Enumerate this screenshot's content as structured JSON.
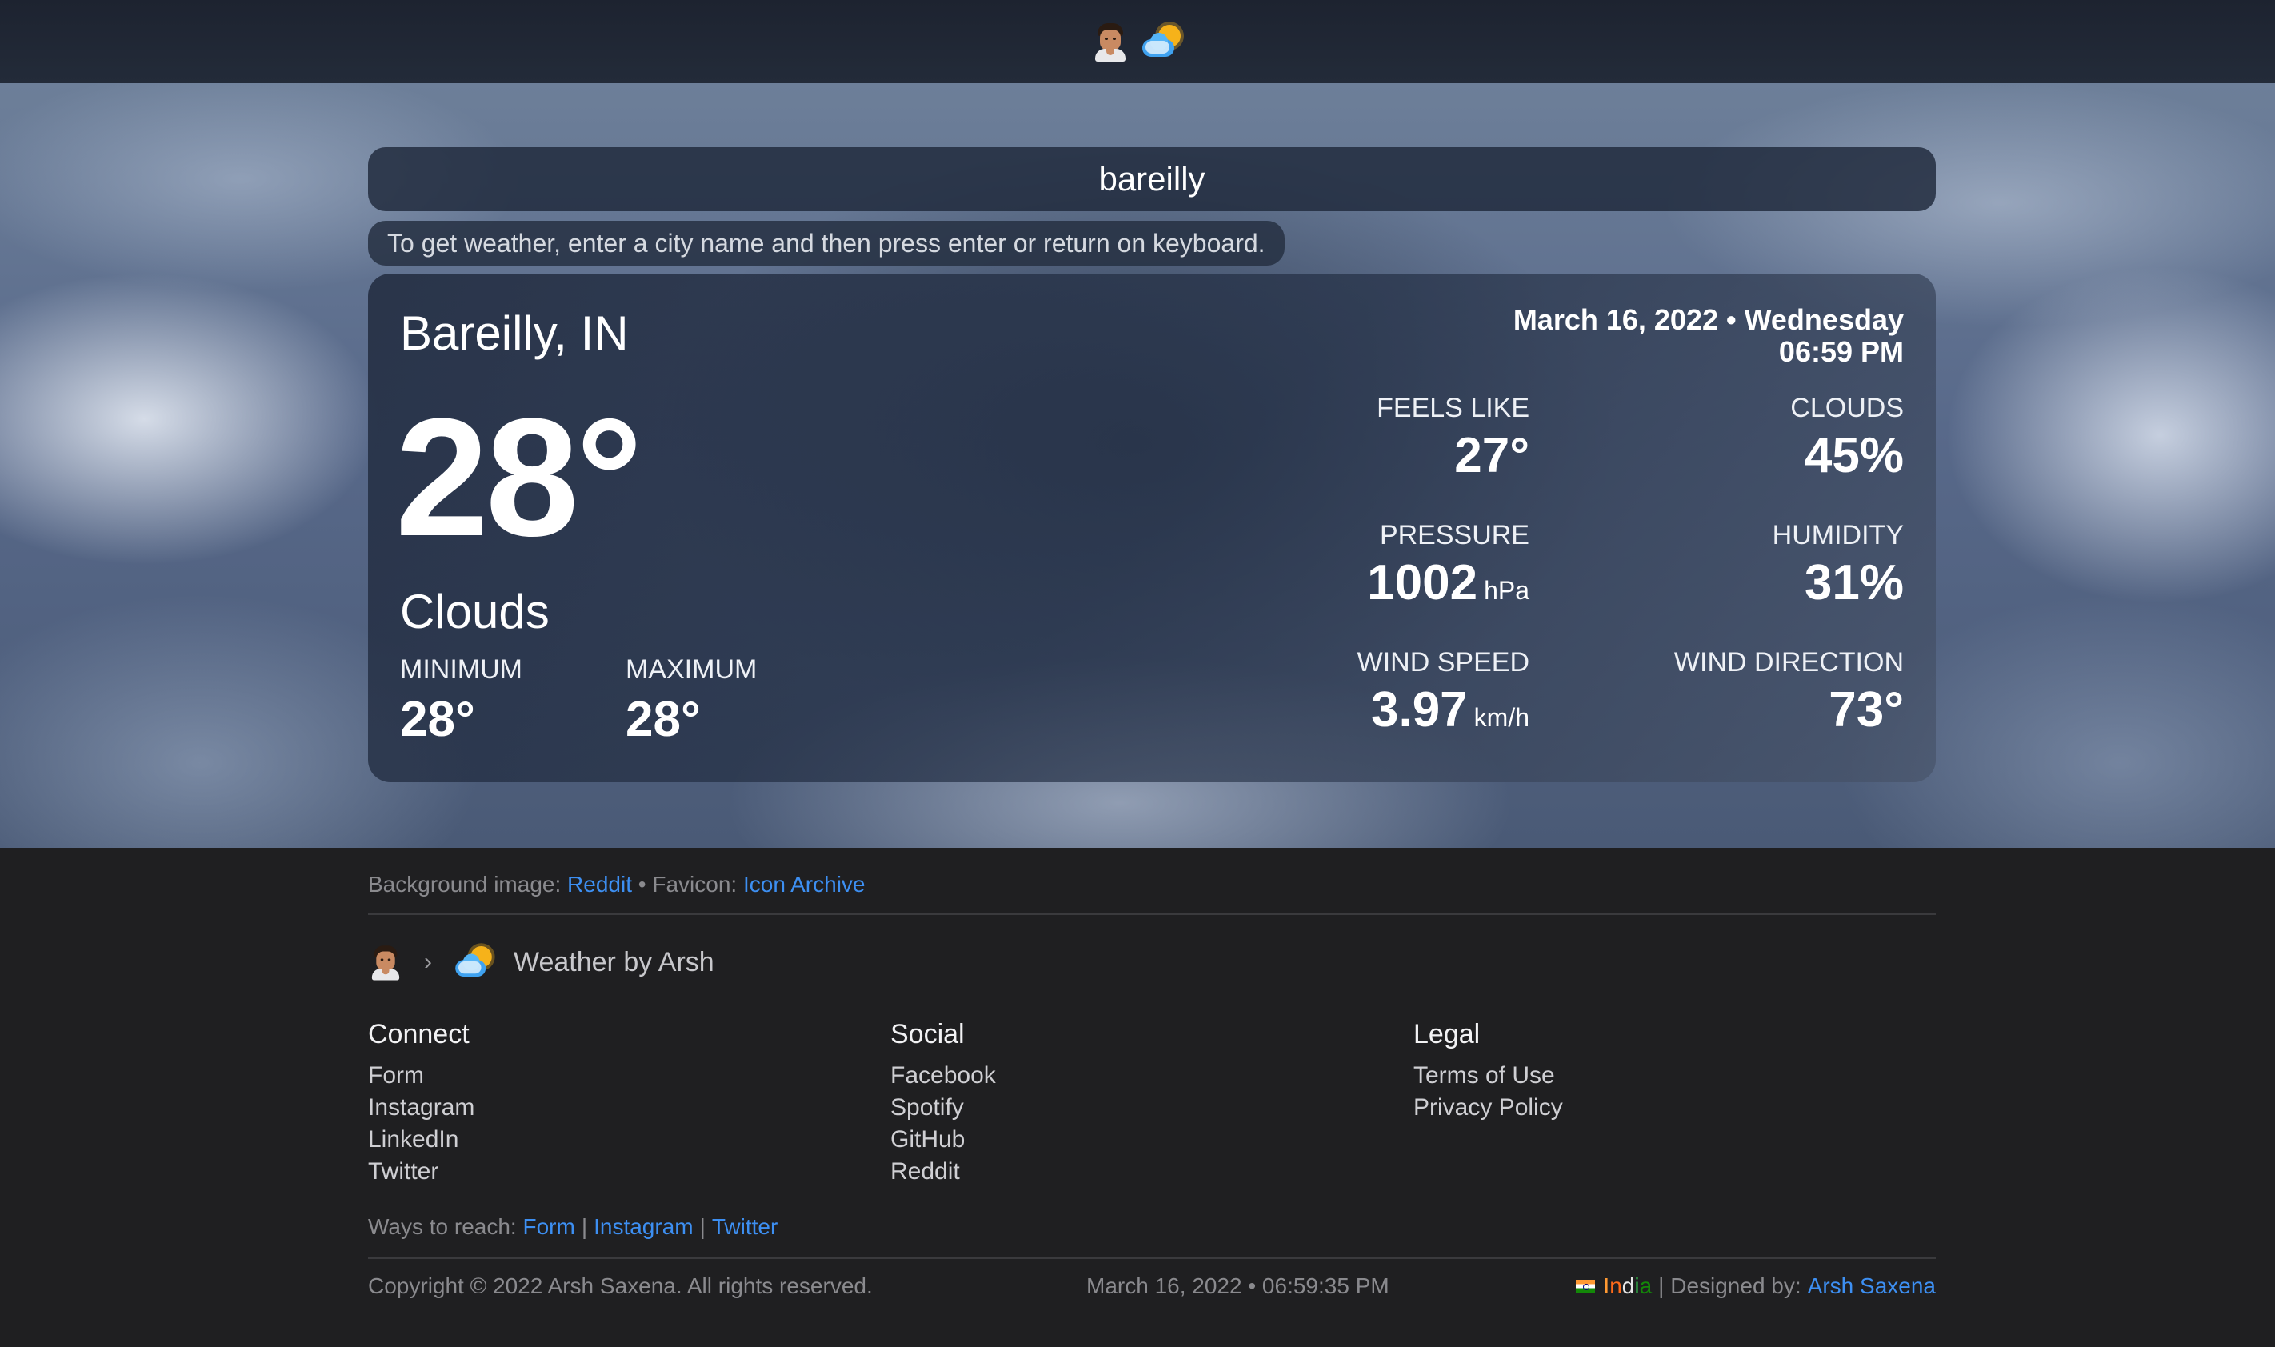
{
  "search": {
    "value": "bareilly",
    "hint": "To get weather, enter a city name and then press enter or return on keyboard."
  },
  "weather": {
    "city": "Bareilly, IN",
    "temperature": "28°",
    "condition": "Clouds",
    "min_label": "MINIMUM",
    "min_value": "28°",
    "max_label": "MAXIMUM",
    "max_value": "28°",
    "date_line": "March 16, 2022 • Wednesday",
    "time_line": "06:59 PM",
    "feels_like_label": "FEELS LIKE",
    "feels_like_value": "27°",
    "clouds_label": "CLOUDS",
    "clouds_value": "45%",
    "pressure_label": "PRESSURE",
    "pressure_value": "1002",
    "pressure_unit": "hPa",
    "humidity_label": "HUMIDITY",
    "humidity_value": "31%",
    "wind_speed_label": "WIND SPEED",
    "wind_speed_value": "3.97",
    "wind_speed_unit": "km/h",
    "wind_direction_label": "WIND DIRECTION",
    "wind_direction_value": "73°"
  },
  "footer": {
    "bg_label": "Background image:",
    "bg_link": "Reddit",
    "dot": "•",
    "favicon_label": "Favicon:",
    "favicon_link": "Icon Archive",
    "chevron": "›",
    "site_title": "Weather by Arsh",
    "columns": [
      {
        "heading": "Connect",
        "items": [
          "Form",
          "Instagram",
          "LinkedIn",
          "Twitter"
        ]
      },
      {
        "heading": "Social",
        "items": [
          "Facebook",
          "Spotify",
          "GitHub",
          "Reddit"
        ]
      },
      {
        "heading": "Legal",
        "items": [
          "Terms of Use",
          "Privacy Policy"
        ]
      }
    ],
    "reach_label": "Ways to reach:",
    "reach_links": [
      "Form",
      "Instagram",
      "Twitter"
    ],
    "pipe": "|",
    "copyright": "Copyright © 2022 Arsh Saxena. All rights reserved.",
    "clock": "March 16, 2022 • 06:59:35 PM",
    "country": [
      "I",
      "n",
      "d",
      "i",
      "a"
    ],
    "designed_label": "| Designed by:",
    "designer": "Arsh Saxena"
  },
  "colors": {
    "link": "#3d8ff2",
    "footer_bg": "#1f1f21",
    "topbar_bg": "#1d2330"
  },
  "icons": {
    "avatar": "avatar-icon",
    "favicon": "weather-cloud-sun-icon",
    "flag": "india-flag-icon"
  }
}
